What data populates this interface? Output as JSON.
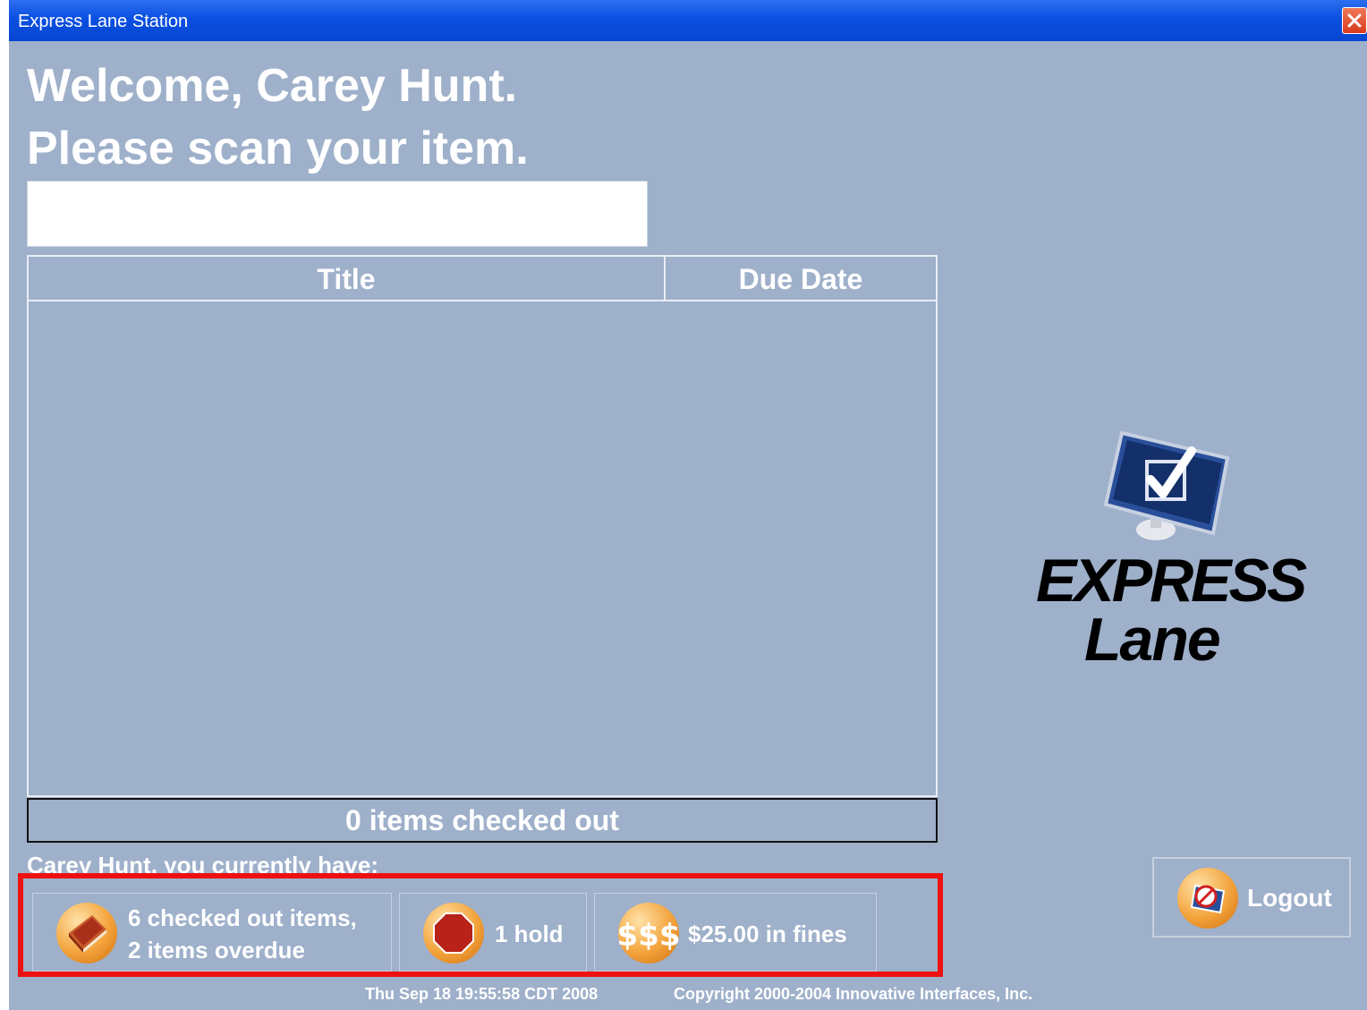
{
  "window": {
    "title": "Express Lane Station",
    "close_icon": "close-icon"
  },
  "header": {
    "welcome": "Welcome, Carey Hunt.",
    "prompt": "Please scan your item."
  },
  "scan": {
    "value": "",
    "placeholder": ""
  },
  "table": {
    "columns": [
      "Title",
      "Due Date"
    ],
    "rows": []
  },
  "status": {
    "items_checked_out": "0 items checked out"
  },
  "summary": {
    "label": "Carey Hunt, you currently have:",
    "checked_out": {
      "line1": "6 checked out items,",
      "line2": "2 items overdue",
      "icon": "book-icon"
    },
    "holds": {
      "label": "1 hold",
      "icon": "stop-sign-icon"
    },
    "fines": {
      "label": "$25.00 in fines",
      "icon": "dollar-sign-icon"
    }
  },
  "logo": {
    "line1": "EXPRESS",
    "line2": "Lane",
    "icon": "monitor-checkmark-icon"
  },
  "logout": {
    "label": "Logout",
    "icon": "logout-icon"
  },
  "footer": {
    "datetime": "Thu Sep 18 19:55:58 CDT 2008",
    "copyright": "Copyright 2000-2004 Innovative Interfaces, Inc."
  },
  "colors": {
    "background": "#9eb0ca",
    "titlebar": "#0a4fe0",
    "highlight_frame": "#ee1111",
    "accent_orb": "#f3a33b"
  }
}
